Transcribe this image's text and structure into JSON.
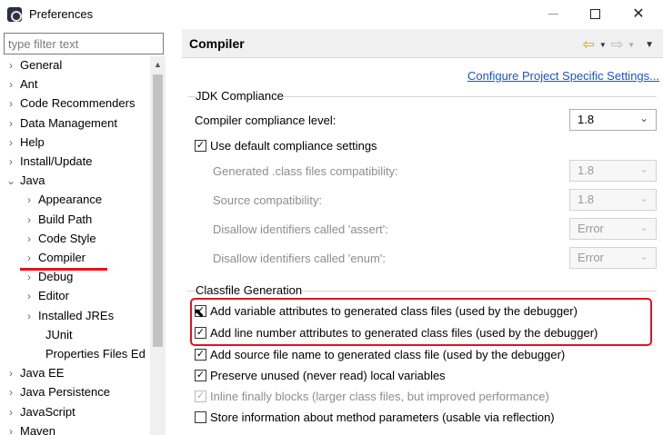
{
  "window": {
    "title": "Preferences",
    "min_icon": "minimize-icon",
    "max_icon": "maximize-icon",
    "close_glyph": "✕"
  },
  "filter": {
    "placeholder": "type filter text",
    "value": ""
  },
  "tree": {
    "items": [
      {
        "label": "General",
        "expander": "›"
      },
      {
        "label": "Ant",
        "expander": "›"
      },
      {
        "label": "Code Recommenders",
        "expander": "›"
      },
      {
        "label": "Data Management",
        "expander": "›"
      },
      {
        "label": "Help",
        "expander": "›"
      },
      {
        "label": "Install/Update",
        "expander": "›"
      },
      {
        "label": "Java",
        "expander": "⌄"
      },
      {
        "label": "Appearance",
        "expander": "›"
      },
      {
        "label": "Build Path",
        "expander": "›"
      },
      {
        "label": "Code Style",
        "expander": "›"
      },
      {
        "label": "Compiler",
        "expander": "›"
      },
      {
        "label": "Debug",
        "expander": "›"
      },
      {
        "label": "Editor",
        "expander": "›"
      },
      {
        "label": "Installed JREs",
        "expander": "›"
      },
      {
        "label": "JUnit",
        "expander": ""
      },
      {
        "label": "Properties Files Ed",
        "expander": ""
      },
      {
        "label": "Java EE",
        "expander": "›"
      },
      {
        "label": "Java Persistence",
        "expander": "›"
      },
      {
        "label": "JavaScript",
        "expander": "›"
      },
      {
        "label": "Maven",
        "expander": "›"
      }
    ],
    "selected": "Compiler"
  },
  "page": {
    "title": "Compiler",
    "config_link": "Configure Project Specific Settings...",
    "nav": {
      "back_glyph": "⇦",
      "fwd_glyph": "⇨",
      "caret": "▼"
    }
  },
  "jdk": {
    "group_label": "JDK Compliance",
    "compliance_label": "Compiler compliance level:",
    "compliance_value": "1.8",
    "use_default_label": "Use default compliance settings",
    "rows": [
      {
        "label": "Generated .class files compatibility:",
        "value": "1.8"
      },
      {
        "label": "Source compatibility:",
        "value": "1.8"
      },
      {
        "label": "Disallow identifiers called 'assert':",
        "value": "Error"
      },
      {
        "label": "Disallow identifiers called 'enum':",
        "value": "Error"
      }
    ]
  },
  "classfile": {
    "group_label": "Classfile Generation",
    "options": [
      {
        "label": "Add variable attributes to generated class files (used by the debugger)",
        "checked": true,
        "enabled": true
      },
      {
        "label": "Add line number attributes to generated class files (used by the debugger)",
        "checked": true,
        "enabled": true
      },
      {
        "label": "Add source file name to generated class file (used by the debugger)",
        "checked": true,
        "enabled": true
      },
      {
        "label": "Preserve unused (never read) local variables",
        "checked": true,
        "enabled": true
      },
      {
        "label": "Inline finally blocks (larger class files, but improved performance)",
        "checked": true,
        "enabled": false
      },
      {
        "label": "Store information about method parameters (usable via reflection)",
        "checked": false,
        "enabled": true
      }
    ]
  },
  "colors": {
    "highlight": "#e0141e",
    "link": "#1a55c0",
    "disabled_text": "#8d8d8d"
  }
}
